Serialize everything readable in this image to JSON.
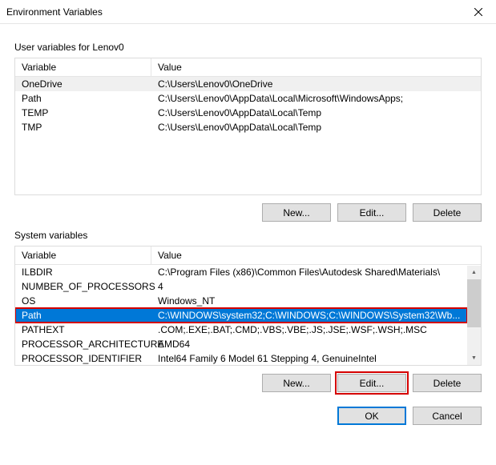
{
  "window": {
    "title": "Environment Variables"
  },
  "userSection": {
    "label": "User variables for Lenov0",
    "headers": {
      "variable": "Variable",
      "value": "Value"
    },
    "rows": [
      {
        "variable": "OneDrive",
        "value": "C:\\Users\\Lenov0\\OneDrive",
        "selected": "gray"
      },
      {
        "variable": "Path",
        "value": "C:\\Users\\Lenov0\\AppData\\Local\\Microsoft\\WindowsApps;"
      },
      {
        "variable": "TEMP",
        "value": "C:\\Users\\Lenov0\\AppData\\Local\\Temp"
      },
      {
        "variable": "TMP",
        "value": "C:\\Users\\Lenov0\\AppData\\Local\\Temp"
      }
    ],
    "buttons": {
      "new": "New...",
      "edit": "Edit...",
      "delete": "Delete"
    }
  },
  "systemSection": {
    "label": "System variables",
    "headers": {
      "variable": "Variable",
      "value": "Value"
    },
    "rows": [
      {
        "variable": "ILBDIR",
        "value": "C:\\Program Files (x86)\\Common Files\\Autodesk Shared\\Materials\\"
      },
      {
        "variable": "NUMBER_OF_PROCESSORS",
        "value": "4"
      },
      {
        "variable": "OS",
        "value": "Windows_NT"
      },
      {
        "variable": "Path",
        "value": "C:\\WINDOWS\\system32;C:\\WINDOWS;C:\\WINDOWS\\System32\\Wb...",
        "selected": "blue"
      },
      {
        "variable": "PATHEXT",
        "value": ".COM;.EXE;.BAT;.CMD;.VBS;.VBE;.JS;.JSE;.WSF;.WSH;.MSC"
      },
      {
        "variable": "PROCESSOR_ARCHITECTURE",
        "value": "AMD64"
      },
      {
        "variable": "PROCESSOR_IDENTIFIER",
        "value": "Intel64 Family 6 Model 61 Stepping 4, GenuineIntel"
      }
    ],
    "buttons": {
      "new": "New...",
      "edit": "Edit...",
      "delete": "Delete"
    }
  },
  "footer": {
    "ok": "OK",
    "cancel": "Cancel"
  }
}
